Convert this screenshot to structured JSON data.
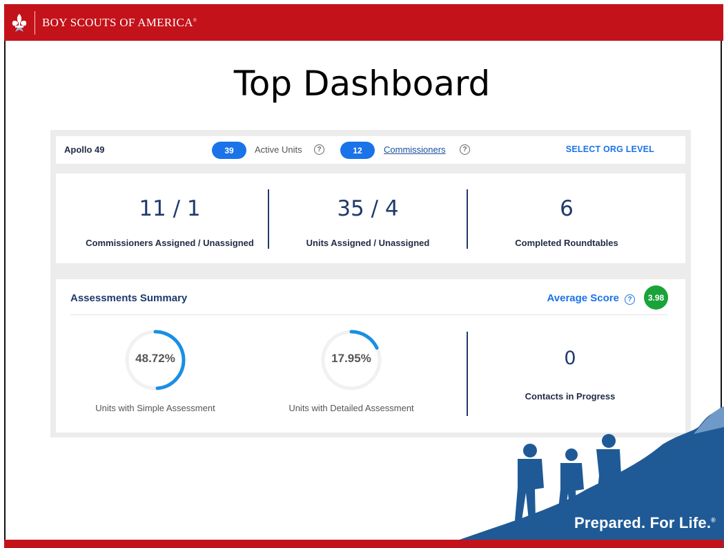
{
  "brand": {
    "name": "BOY SCOUTS OF AMERICA",
    "reg": "®"
  },
  "slide": {
    "title": "Top Dashboard"
  },
  "header": {
    "org_name": "Apollo 49",
    "active_units_count": "39",
    "active_units_label": "Active Units",
    "commissioners_count": "12",
    "commissioners_label": "Commissioners",
    "select_org_label": "SELECT ORG LEVEL",
    "help_glyph": "?"
  },
  "stats": [
    {
      "value": "11 / 1",
      "label": "Commissioners Assigned / Unassigned"
    },
    {
      "value": "35 / 4",
      "label": "Units Assigned / Unassigned"
    },
    {
      "value": "6",
      "label": "Completed Roundtables"
    }
  ],
  "assessments": {
    "title": "Assessments Summary",
    "average_label": "Average Score",
    "average_score": "3.98",
    "simple": {
      "percent": "48.72%",
      "fraction": 0.4872,
      "label": "Units with Simple Assessment"
    },
    "detailed": {
      "percent": "17.95%",
      "fraction": 0.1795,
      "label": "Units with Detailed Assessment"
    },
    "contacts_value": "0",
    "contacts_label": "Contacts in Progress"
  },
  "footer": {
    "tagline": "Prepared. For Life.",
    "tagline_mark": "®"
  },
  "colors": {
    "brand_red": "#c4121a",
    "accent_blue": "#1a73e8",
    "navy": "#1f3a6b",
    "badge_green": "#1aa33a",
    "mountain_blue": "#1f5a96"
  }
}
